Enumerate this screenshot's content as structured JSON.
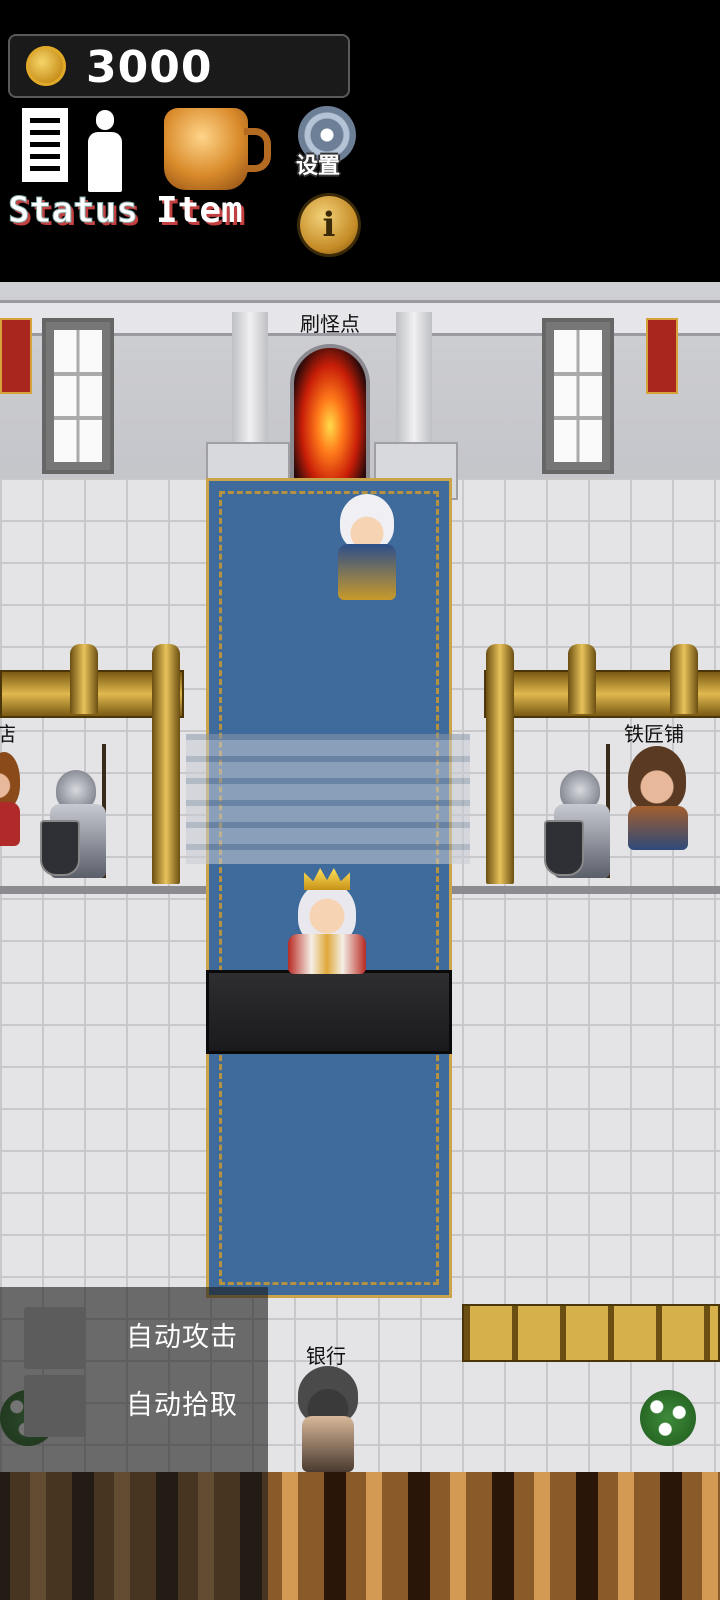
{
  "hud": {
    "coins": "3000",
    "status_label": "Status",
    "item_label": "Item",
    "settings_label": "设置",
    "info_label": "i"
  },
  "map": {
    "spawn_point_label": "刷怪点",
    "npc_blacksmith_label": "铁匠铺",
    "npc_bank_label": "银行",
    "npc_left_partial_label": "店"
  },
  "controls": {
    "auto_attack_label": "自动攻击",
    "auto_pickup_label": "自动拾取"
  },
  "icons": [
    "coin-icon",
    "document-icon",
    "person-icon",
    "mug-icon",
    "gear-icon",
    "info-icon"
  ]
}
